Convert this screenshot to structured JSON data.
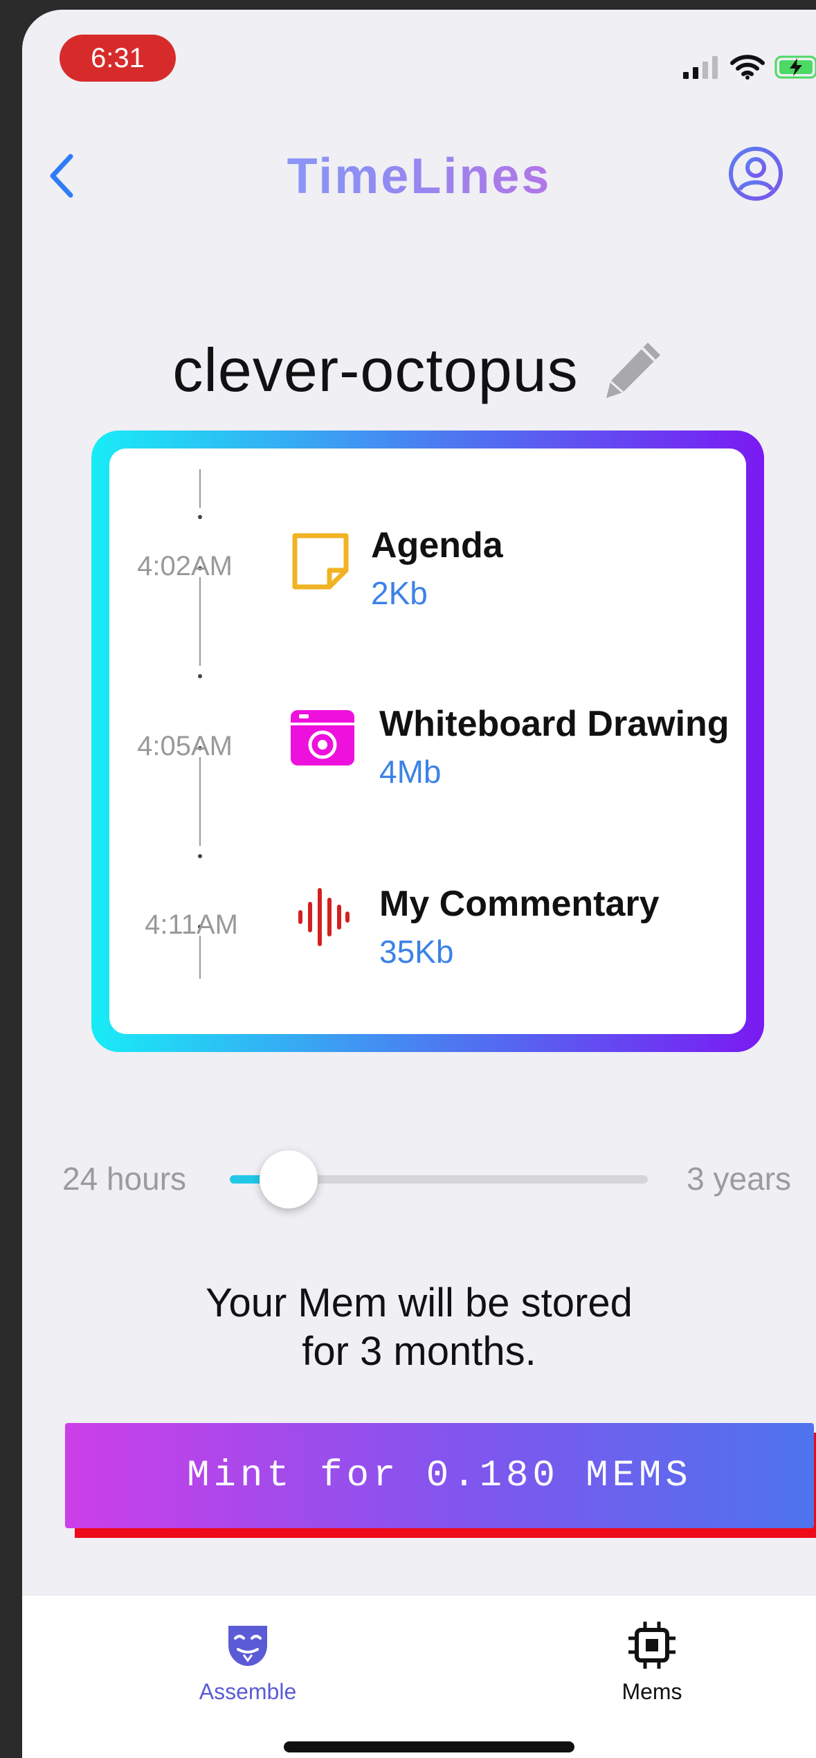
{
  "status_bar": {
    "time": "6:31"
  },
  "nav": {
    "title": "TimeLines"
  },
  "mem": {
    "name": "clever-octopus"
  },
  "timeline": [
    {
      "time": "4:02AM",
      "title": "Agenda",
      "size": "2Kb",
      "icon": "sticky-note-icon",
      "color": "#f0b323"
    },
    {
      "time": "4:05AM",
      "title": "Whiteboard Drawing",
      "size": "4Mb",
      "icon": "camera-icon",
      "color": "#ee11dd"
    },
    {
      "time": "4:11AM",
      "title": "My Commentary",
      "size": "35Kb",
      "icon": "audio-waveform-icon",
      "color": "#d42020"
    }
  ],
  "slider": {
    "min_label": "24 hours",
    "max_label": "3 years",
    "fraction": 0.14
  },
  "storage": {
    "line1": "Your Mem will be stored",
    "line2": "for 3 months."
  },
  "mint_button": {
    "label": "Mint for 0.180 MEMS"
  },
  "tabs": [
    {
      "label": "Assemble",
      "icon": "mask-icon",
      "active": true
    },
    {
      "label": "Mems",
      "icon": "chip-icon",
      "active": false
    }
  ],
  "colors": {
    "accent_blue": "#3b82e6",
    "active_tab": "#5b5bd6"
  }
}
